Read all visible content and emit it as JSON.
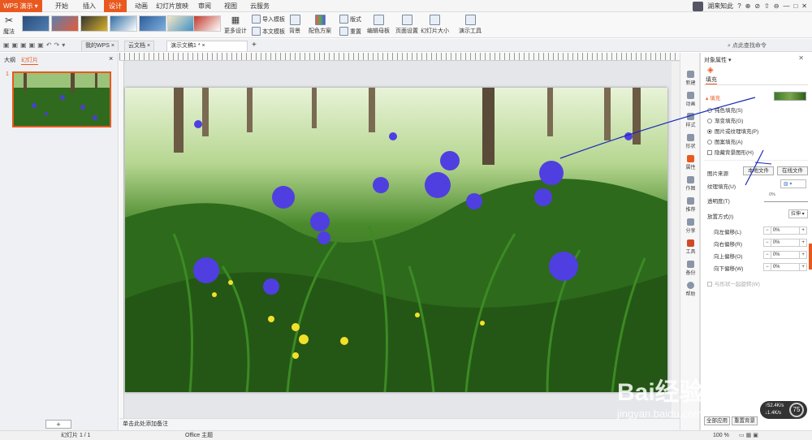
{
  "app": {
    "title": "WPS 演示"
  },
  "menu": [
    "开始",
    "插入",
    "设计",
    "动画",
    "幻灯片放映",
    "审阅",
    "视图",
    "云服务"
  ],
  "menu_active": "设计",
  "topright": {
    "user": "湖来知此",
    "items": [
      "?",
      "⊕",
      "⊘",
      "⇧",
      "⊖",
      "—",
      "□",
      "✕"
    ]
  },
  "ribbon": {
    "magic": "魔法",
    "more_design": "更多设计",
    "import_template": "导入模板",
    "text_template": "本文模板",
    "background": "背景",
    "color_scheme": "配色方案",
    "layout": "版式",
    "reset": "重置",
    "edit_master": "编辑母板",
    "page_setup": "页面设置",
    "slide_size": "幻灯片大小",
    "presentation_tools": "演示工具"
  },
  "tabs": [
    {
      "label": "我的WPS",
      "active": false
    },
    {
      "label": "云文档",
      "active": false
    },
    {
      "label": "演示文稿1 *",
      "active": true
    }
  ],
  "tab_add": "+",
  "search": {
    "placeholder": "点此查找命令"
  },
  "left_panel": {
    "tab_outline": "大纲",
    "tab_slides": "幻灯片",
    "slide_number": "1",
    "close": "×",
    "add": "+"
  },
  "notes": {
    "placeholder": "单击此处添加备注"
  },
  "status": {
    "slide_info": "幻灯片 1 / 1",
    "theme": "Office 主题",
    "zoom": "100 %"
  },
  "side_tools": [
    "新建",
    "动画",
    "样式",
    "形状",
    "属性",
    "作图",
    "推荐",
    "分享",
    "工具",
    "备份",
    "帮助"
  ],
  "props": {
    "title": "对象属性",
    "tab_fill": "填充",
    "section_fill": "填充",
    "fill_options": [
      {
        "label": "纯色填充(S)",
        "selected": false
      },
      {
        "label": "渐变填充(G)",
        "selected": false
      },
      {
        "label": "图片或纹理填充(P)",
        "selected": true
      },
      {
        "label": "图案填充(A)",
        "selected": false
      }
    ],
    "hide_bg": "隐藏背景图形(H)",
    "image_source": "图片来源",
    "local_file": "本地文件",
    "online_file": "在线文件",
    "texture_fill": "纹理填充(U)",
    "transparency": "透明度(T)",
    "transparency_value": "0%",
    "placement": "放置方式(I)",
    "placement_value": "拉伸",
    "offsets": [
      {
        "label": "向左偏移(L)",
        "value": "0%"
      },
      {
        "label": "向右偏移(R)",
        "value": "0%"
      },
      {
        "label": "向上偏移(O)",
        "value": "0%"
      },
      {
        "label": "向下偏移(W)",
        "value": "0%"
      }
    ],
    "rotate_with_shape": "与形状一起旋转(W)",
    "apply_all": "全部应用",
    "reset_bg": "重置背景"
  },
  "net": {
    "up": "52.4K/s",
    "down": "1.4K/s",
    "percent": "75"
  },
  "watermark": {
    "brand": "Bai经验",
    "url": "jingyan.baidu.com"
  }
}
